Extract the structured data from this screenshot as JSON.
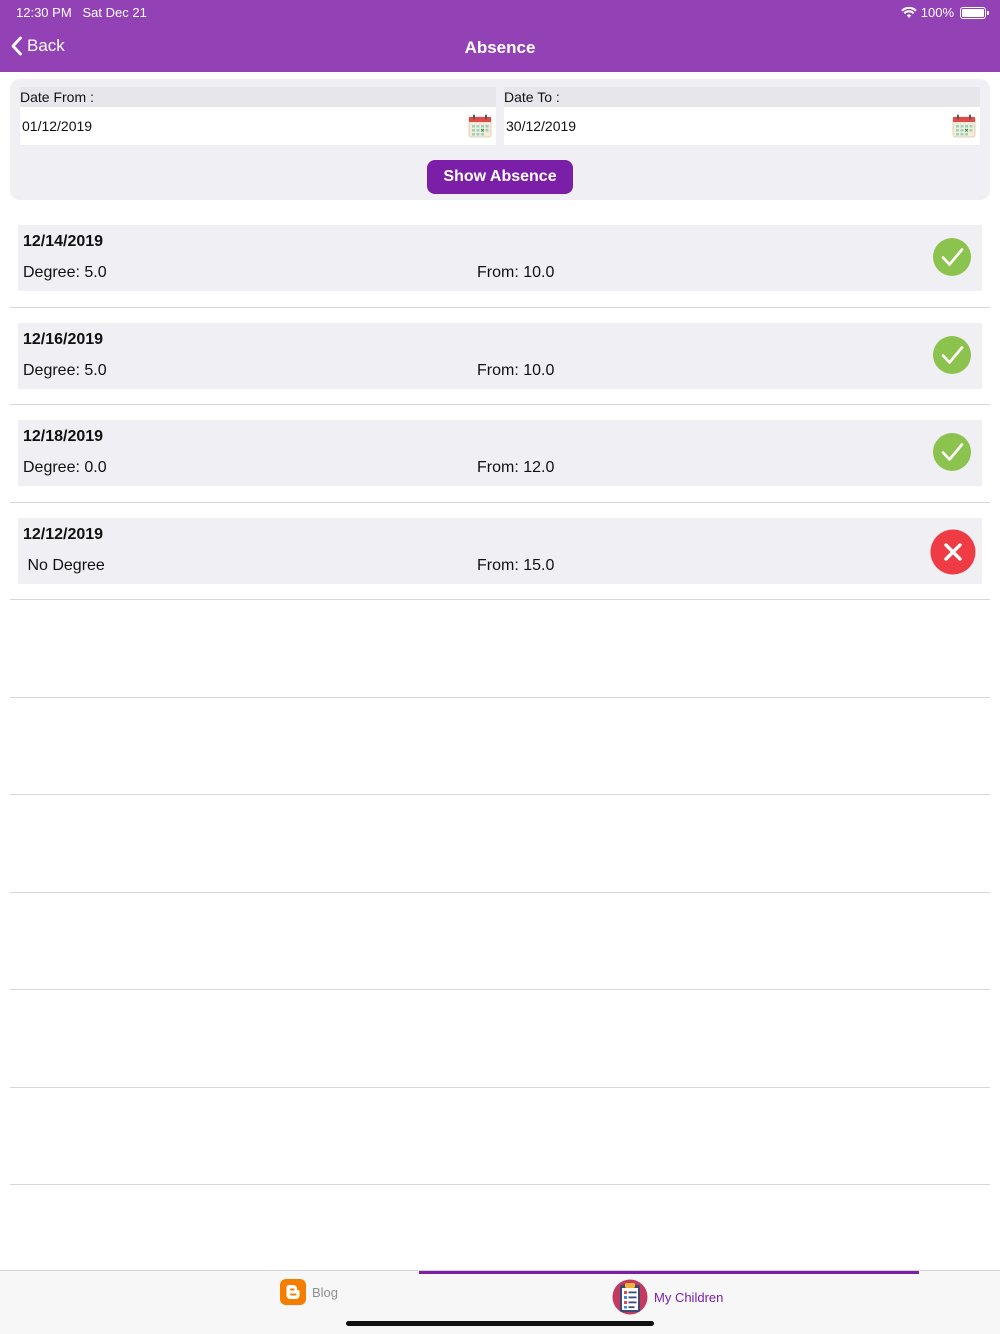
{
  "status_bar": {
    "time": "12:30 PM",
    "date": "Sat Dec 21",
    "battery": "100%"
  },
  "nav": {
    "back_label": "Back",
    "title": "Absence"
  },
  "filter": {
    "from_label": "Date From :",
    "from_value": "01/12/2019",
    "to_label": "Date To :",
    "to_value": "30/12/2019",
    "button_label": "Show Absence"
  },
  "records": [
    {
      "date": "12/14/2019",
      "degree": "Degree: 5.0",
      "from": "From: 10.0",
      "status": "approved"
    },
    {
      "date": "12/16/2019",
      "degree": "Degree: 5.0",
      "from": "From: 10.0",
      "status": "approved"
    },
    {
      "date": "12/18/2019",
      "degree": "Degree: 0.0",
      "from": "From: 12.0",
      "status": "approved"
    },
    {
      "date": "12/12/2019",
      "degree": " No Degree",
      "from": "From: 15.0",
      "status": "rejected"
    }
  ],
  "tabs": [
    {
      "label": "Blog",
      "icon": "blogger-icon",
      "active": false
    },
    {
      "label": "My Children",
      "icon": "clipboard-icon",
      "active": true
    }
  ],
  "colors": {
    "header": "#9342b5",
    "accent": "#7b1fa8",
    "approved": "#8cc34e",
    "rejected": "#ef3b43"
  }
}
